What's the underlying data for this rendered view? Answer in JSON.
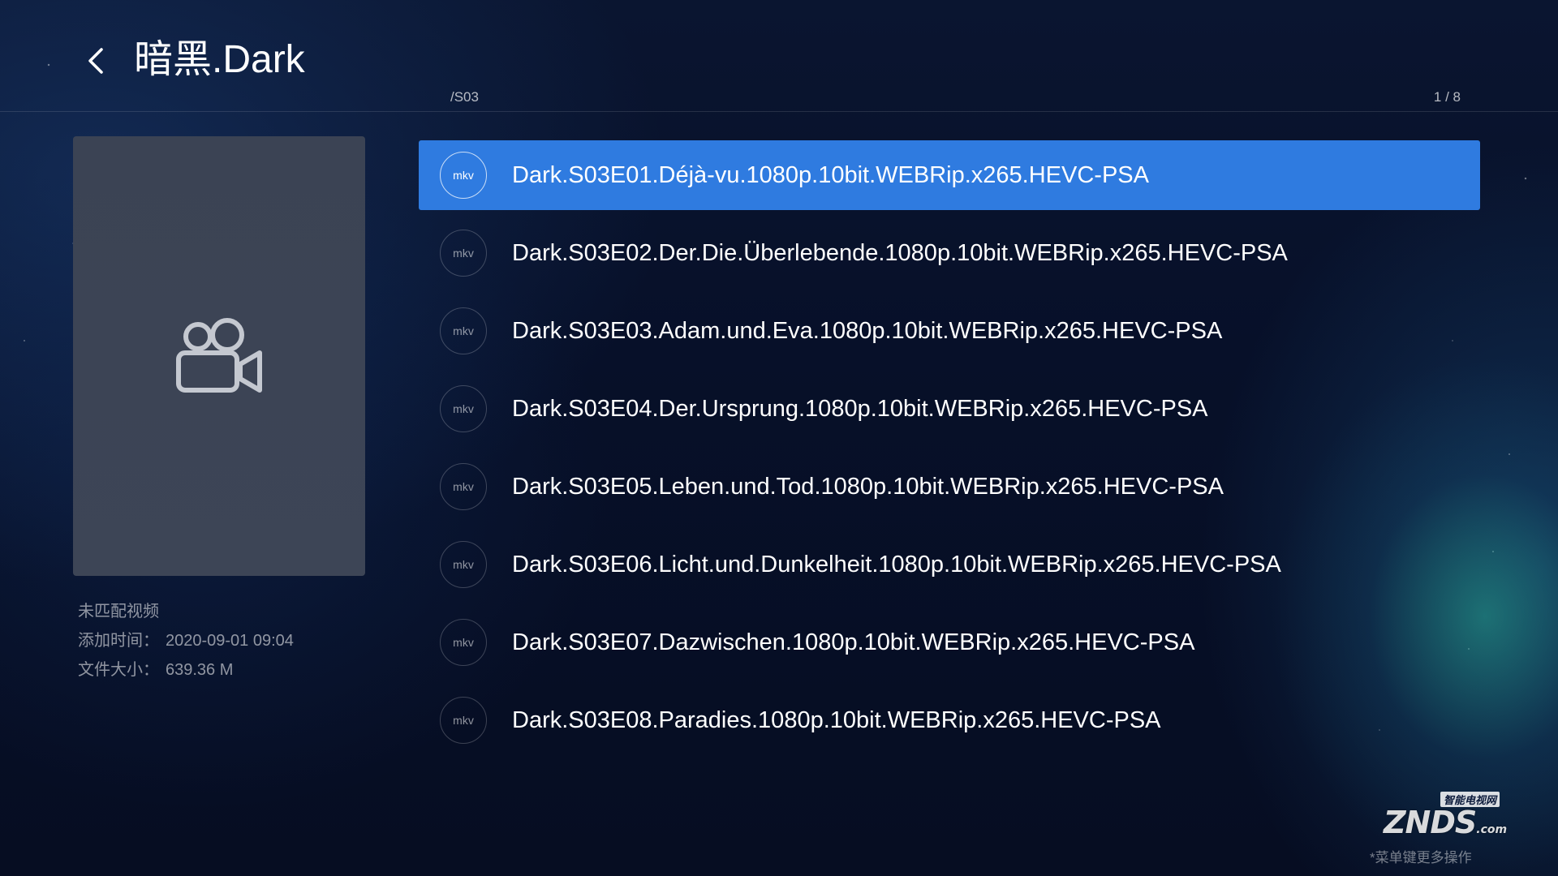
{
  "header": {
    "title": "暗黑.Dark",
    "path": "/S03",
    "pager": "1 / 8"
  },
  "details": {
    "status": "未匹配视频",
    "added_label": "添加时间：",
    "added_value": "2020-09-01 09:04",
    "size_label": "文件大小：",
    "size_value": "639.36 M"
  },
  "files": [
    {
      "ext": "mkv",
      "name": "Dark.S03E01.Déjà-vu.1080p.10bit.WEBRip.x265.HEVC-PSA",
      "selected": true
    },
    {
      "ext": "mkv",
      "name": "Dark.S03E02.Der.Die.Überlebende.1080p.10bit.WEBRip.x265.HEVC-PSA",
      "selected": false
    },
    {
      "ext": "mkv",
      "name": "Dark.S03E03.Adam.und.Eva.1080p.10bit.WEBRip.x265.HEVC-PSA",
      "selected": false
    },
    {
      "ext": "mkv",
      "name": "Dark.S03E04.Der.Ursprung.1080p.10bit.WEBRip.x265.HEVC-PSA",
      "selected": false
    },
    {
      "ext": "mkv",
      "name": "Dark.S03E05.Leben.und.Tod.1080p.10bit.WEBRip.x265.HEVC-PSA",
      "selected": false
    },
    {
      "ext": "mkv",
      "name": "Dark.S03E06.Licht.und.Dunkelheit.1080p.10bit.WEBRip.x265.HEVC-PSA",
      "selected": false
    },
    {
      "ext": "mkv",
      "name": "Dark.S03E07.Dazwischen.1080p.10bit.WEBRip.x265.HEVC-PSA",
      "selected": false
    },
    {
      "ext": "mkv",
      "name": "Dark.S03E08.Paradies.1080p.10bit.WEBRip.x265.HEVC-PSA",
      "selected": false
    }
  ],
  "watermark": {
    "logo": "ZNDS",
    "logo_suffix": ".com",
    "tag": "智能电视网"
  },
  "hint": "*菜单键更多操作",
  "icons": {
    "back": "chevron-left-icon",
    "poster": "video-camera-icon"
  },
  "colors": {
    "accent": "#2f7be0",
    "poster_bg": "#3c4455"
  }
}
